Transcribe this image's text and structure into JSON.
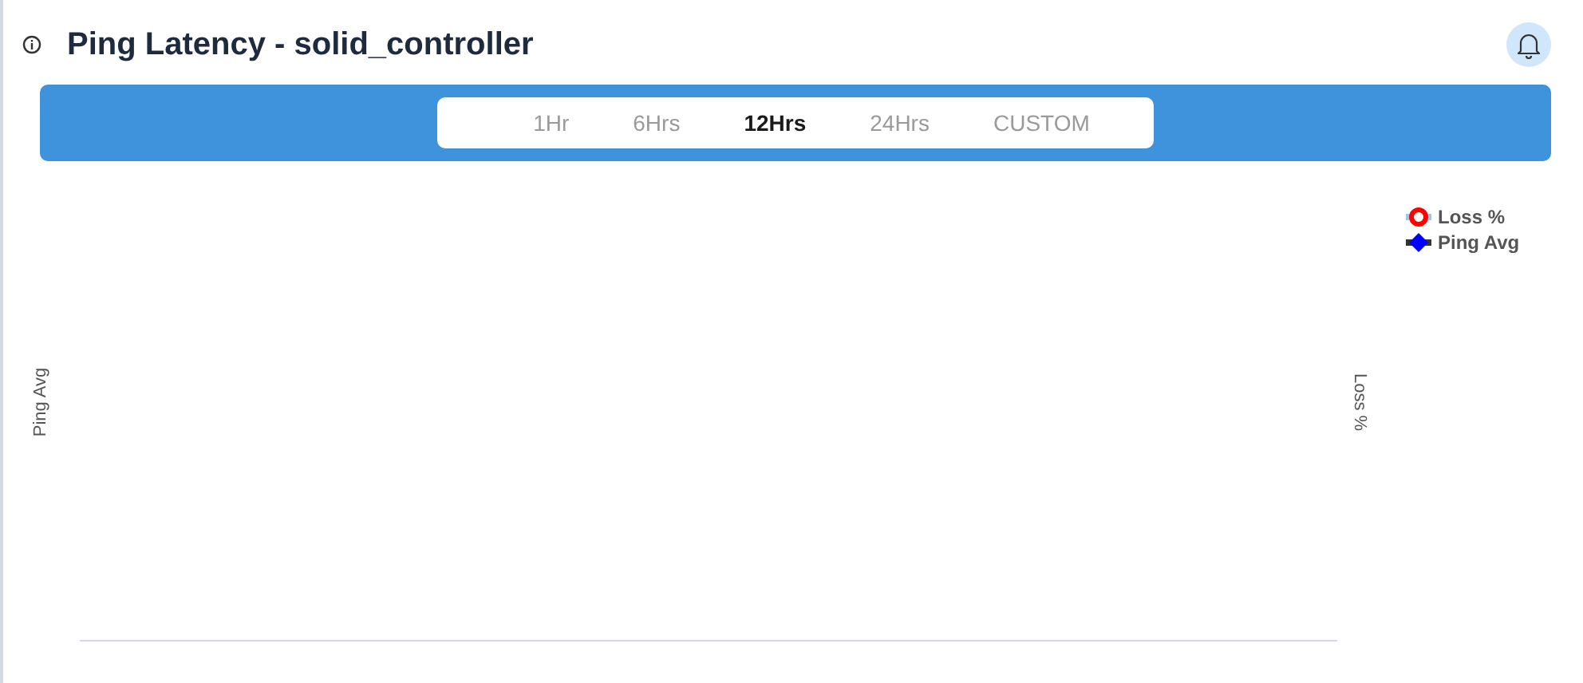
{
  "header": {
    "title": "Ping Latency - solid_controller"
  },
  "ranges": [
    {
      "label": "1Hr",
      "selected": false
    },
    {
      "label": "6Hrs",
      "selected": false
    },
    {
      "label": "12Hrs",
      "selected": true
    },
    {
      "label": "24Hrs",
      "selected": false
    },
    {
      "label": "CUSTOM",
      "selected": false
    }
  ],
  "chart": {
    "ylabel": "Ping Avg",
    "ylabel_right": "Loss %",
    "legend": [
      {
        "name": "Loss %",
        "kind": "circle",
        "color": "#ff0000"
      },
      {
        "name": "Ping Avg",
        "kind": "diamond",
        "color": "#0000ff"
      }
    ]
  }
}
